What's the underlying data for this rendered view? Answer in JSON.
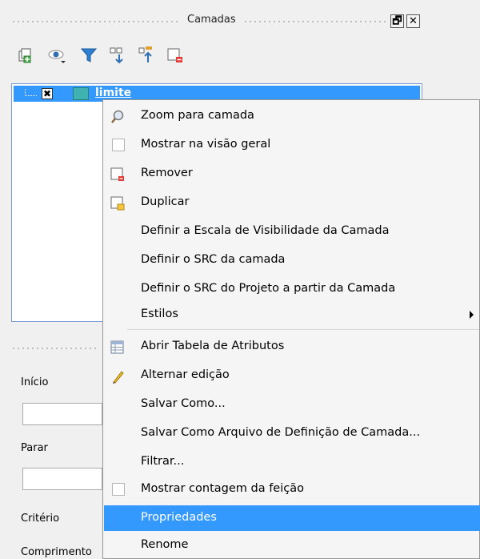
{
  "dock": {
    "title": "Camadas",
    "float_glyph": "🗗",
    "close_glyph": "✕"
  },
  "toolbar": {
    "buttons": [
      {
        "icon": "add-group-icon"
      },
      {
        "icon": "visibility-eye-icon"
      },
      {
        "icon": "filter-legend-icon"
      },
      {
        "icon": "expand-all-icon"
      },
      {
        "icon": "collapse-all-icon"
      },
      {
        "icon": "remove-layer-icon"
      }
    ]
  },
  "layer_tree": {
    "layers": [
      {
        "name": "limite",
        "checked_glyph": "✖",
        "color": "#3fb2b2"
      }
    ]
  },
  "lower_panel": {
    "labels": {
      "start": "Início",
      "stop": "Parar",
      "criterion": "Critério",
      "length": "Comprimento"
    }
  },
  "context_menu": {
    "items": [
      {
        "label": "Zoom para camada",
        "icon": "zoom-magnifier-icon"
      },
      {
        "label": "Mostrar na visão geral",
        "icon": "checkbox-icon"
      },
      {
        "label": "Remover",
        "icon": "remove-layer-icon"
      },
      {
        "label": "Duplicar",
        "icon": "duplicate-layer-icon"
      },
      {
        "label": "Definir a Escala de Visibilidade da Camada",
        "icon": ""
      },
      {
        "label": "Definir o SRC da camada",
        "icon": ""
      },
      {
        "label": "Definir o SRC do Projeto a partir da Camada",
        "icon": ""
      },
      {
        "label": "Estilos",
        "icon": "",
        "submenu": true
      },
      {
        "label": "Abrir Tabela de Atributos",
        "icon": "attribute-table-icon"
      },
      {
        "label": "Alternar edição",
        "icon": "pencil-icon"
      },
      {
        "label": "Salvar Como...",
        "icon": ""
      },
      {
        "label": "Salvar Como Arquivo de Definição de Camada...",
        "icon": ""
      },
      {
        "label": "Filtrar...",
        "icon": ""
      },
      {
        "label": "Mostrar contagem da feição",
        "icon": "checkbox-icon"
      },
      {
        "label": "Propriedades",
        "icon": "",
        "selected": true
      },
      {
        "label": "Renome",
        "icon": ""
      }
    ]
  },
  "colors": {
    "selection": "#3399ff",
    "menu_bg": "#f5f5f5",
    "panel_bg": "#f0f0f0"
  }
}
